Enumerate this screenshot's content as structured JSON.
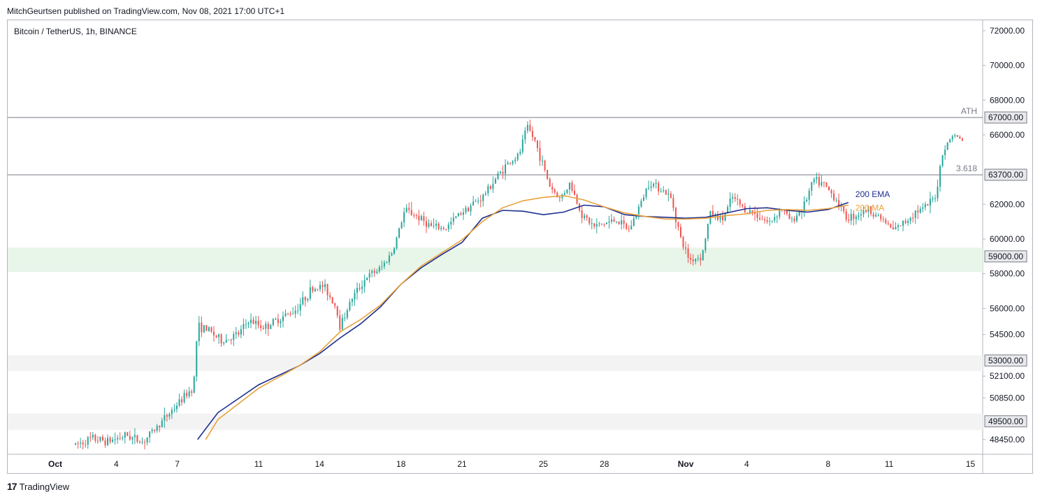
{
  "header": {
    "published": "MitchGeurtsen published on TradingView.com, Nov 08, 2021 17:00 UTC+1",
    "symbol": "Bitcoin / TetherUS, 1h, BINANCE"
  },
  "footer": {
    "brand": "TradingView",
    "logo_glyph": "17"
  },
  "colors": {
    "up": "#26a69a",
    "down": "#ef5350",
    "ema": "#1e2e8f",
    "ma": "#e8a13a",
    "green_zone": "#e8f5e9",
    "grey_zone": "#f3f3f3",
    "line": "#787b86"
  },
  "chart_data": {
    "type": "candlestick",
    "title": "Bitcoin / TetherUS, 1h, BINANCE",
    "ylim": [
      47600,
      72600
    ],
    "y_ticks": [
      "72000.00",
      "70000.00",
      "68000.00",
      "66000.00",
      "62000.00",
      "60000.00",
      "58000.00",
      "56000.00",
      "54500.00",
      "52100.00",
      "50850.00",
      "48450.00"
    ],
    "x_ticks": [
      "Oct",
      "4",
      "7",
      "11",
      "14",
      "18",
      "21",
      "25",
      "28",
      "Nov",
      "4",
      "8",
      "11",
      "15"
    ],
    "levels": [
      {
        "label": "ATH",
        "price_label": "67000.00",
        "value": 67000
      },
      {
        "label": "3.618",
        "price_label": "63700.00",
        "value": 63700
      }
    ],
    "zone_labels": [
      "59000.00",
      "53000.00",
      "49500.00"
    ],
    "zones": [
      {
        "kind": "green",
        "from": 58100,
        "to": 59500
      },
      {
        "kind": "grey",
        "from": 52400,
        "to": 53300
      },
      {
        "kind": "grey",
        "from": 49000,
        "to": 49950
      }
    ],
    "series": [
      {
        "name": "200 EMA",
        "values": [
          [
            7.0,
            48450
          ],
          [
            8,
            50000
          ],
          [
            10,
            51600
          ],
          [
            12,
            52700
          ],
          [
            13,
            53400
          ],
          [
            14,
            54300
          ],
          [
            15,
            55100
          ],
          [
            16,
            56100
          ],
          [
            17,
            57400
          ],
          [
            18,
            58350
          ],
          [
            19,
            59100
          ],
          [
            20,
            59800
          ],
          [
            21,
            61200
          ],
          [
            22,
            61650
          ],
          [
            23,
            61600
          ],
          [
            24,
            61400
          ],
          [
            25,
            61550
          ],
          [
            26,
            61950
          ],
          [
            27,
            61850
          ],
          [
            28,
            61400
          ],
          [
            29,
            61300
          ],
          [
            30,
            61250
          ],
          [
            31,
            61200
          ],
          [
            32,
            61250
          ],
          [
            33,
            61500
          ],
          [
            34,
            61750
          ],
          [
            35,
            61800
          ],
          [
            36,
            61650
          ],
          [
            37,
            61550
          ],
          [
            38,
            61700
          ],
          [
            39,
            62100
          ]
        ]
      },
      {
        "name": "200 MA",
        "values": [
          [
            7.4,
            48450
          ],
          [
            8,
            49600
          ],
          [
            10,
            51400
          ],
          [
            12,
            52700
          ],
          [
            13,
            53500
          ],
          [
            14,
            54650
          ],
          [
            15,
            55350
          ],
          [
            16,
            56200
          ],
          [
            17,
            57400
          ],
          [
            18,
            58450
          ],
          [
            19,
            59200
          ],
          [
            20,
            59950
          ],
          [
            21,
            61000
          ],
          [
            22,
            61800
          ],
          [
            23,
            62200
          ],
          [
            24,
            62400
          ],
          [
            25,
            62500
          ],
          [
            26,
            62250
          ],
          [
            27,
            61850
          ],
          [
            28,
            61500
          ],
          [
            29,
            61300
          ],
          [
            30,
            61150
          ],
          [
            31,
            61150
          ],
          [
            32,
            61200
          ],
          [
            33,
            61350
          ],
          [
            34,
            61450
          ],
          [
            35,
            61650
          ],
          [
            36,
            61700
          ],
          [
            37,
            61650
          ],
          [
            38,
            61750
          ],
          [
            39,
            61950
          ]
        ]
      }
    ],
    "price_path": [
      [
        1,
        48150
      ],
      [
        1.8,
        48500
      ],
      [
        2.6,
        48350
      ],
      [
        3.5,
        48700
      ],
      [
        4.3,
        48300
      ],
      [
        5.1,
        49300
      ],
      [
        6.1,
        50600
      ],
      [
        6.8,
        51500
      ],
      [
        7.0,
        55000
      ],
      [
        7.6,
        54700
      ],
      [
        8.2,
        54100
      ],
      [
        9.0,
        54500
      ],
      [
        9.5,
        55300
      ],
      [
        10.3,
        54900
      ],
      [
        11.0,
        55400
      ],
      [
        11.8,
        55900
      ],
      [
        12.6,
        57100
      ],
      [
        13.2,
        57300
      ],
      [
        13.8,
        56100
      ],
      [
        14.0,
        55000
      ],
      [
        14.6,
        56600
      ],
      [
        15.3,
        57800
      ],
      [
        16.0,
        58300
      ],
      [
        16.6,
        59300
      ],
      [
        17.2,
        61700
      ],
      [
        17.8,
        61300
      ],
      [
        18.5,
        60700
      ],
      [
        19.2,
        60600
      ],
      [
        19.8,
        61400
      ],
      [
        20.5,
        62000
      ],
      [
        21.0,
        62400
      ],
      [
        21.6,
        63400
      ],
      [
        22.2,
        64300
      ],
      [
        22.8,
        64800
      ],
      [
        23.2,
        66500
      ],
      [
        23.6,
        65600
      ],
      [
        24.0,
        64200
      ],
      [
        24.3,
        63100
      ],
      [
        24.8,
        62300
      ],
      [
        25.3,
        63200
      ],
      [
        25.9,
        61400
      ],
      [
        26.5,
        60700
      ],
      [
        27.0,
        60900
      ],
      [
        27.6,
        61100
      ],
      [
        28.2,
        60500
      ],
      [
        28.8,
        62100
      ],
      [
        29.2,
        63300
      ],
      [
        29.8,
        62900
      ],
      [
        30.3,
        62300
      ],
      [
        30.8,
        59800
      ],
      [
        31.2,
        58800
      ],
      [
        31.8,
        59000
      ],
      [
        32.2,
        61500
      ],
      [
        32.8,
        61100
      ],
      [
        33.3,
        62400
      ],
      [
        33.9,
        61700
      ],
      [
        34.5,
        61400
      ],
      [
        35.1,
        60900
      ],
      [
        35.7,
        61800
      ],
      [
        36.2,
        61000
      ],
      [
        36.8,
        61900
      ],
      [
        37.3,
        63400
      ],
      [
        37.8,
        63100
      ],
      [
        38.4,
        62300
      ],
      [
        38.9,
        61200
      ],
      [
        39.4,
        61400
      ],
      [
        40.0,
        61700
      ],
      [
        40.6,
        61200
      ],
      [
        41.2,
        60500
      ],
      [
        41.8,
        61000
      ],
      [
        42.3,
        61600
      ],
      [
        42.8,
        61800
      ],
      [
        43.3,
        62500
      ],
      [
        43.6,
        64900
      ],
      [
        44.1,
        66000
      ],
      [
        44.6,
        65700
      ]
    ],
    "candle_count": 360
  }
}
